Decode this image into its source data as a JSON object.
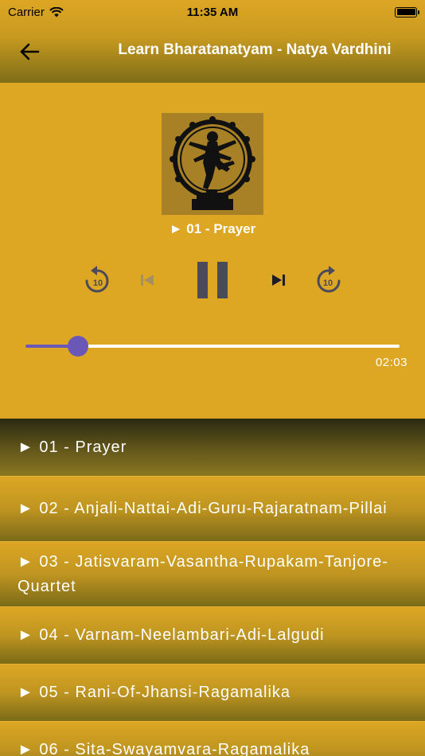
{
  "status_bar": {
    "carrier": "Carrier",
    "time": "11:35 AM",
    "battery_level": 1.0
  },
  "nav": {
    "title": "Learn Bharatanatyam - Natya Vardhini",
    "back_icon": "arrow-left-icon"
  },
  "player": {
    "now_playing": "► 01 - Prayer",
    "artwork": "nataraja-image",
    "controls": {
      "rewind_label": "10",
      "forward_label": "10",
      "rewind_icon": "rewind-10-icon",
      "previous_icon": "skip-previous-icon",
      "pause_icon": "pause-icon",
      "next_icon": "skip-next-icon",
      "forward_icon": "forward-10-icon"
    },
    "progress_fraction": 0.14,
    "elapsed_time": "02:03"
  },
  "tracks": [
    {
      "label": "► 01 - Prayer",
      "active": true
    },
    {
      "label": "► 02 - Anjali-Nattai-Adi-Guru-Rajaratnam-Pillai",
      "active": false
    },
    {
      "label": "► 03 - Jatisvaram-Vasantha-Rupakam-Tanjore-Quartet",
      "active": false
    },
    {
      "label": "► 04 - Varnam-Neelambari-Adi-Lalgudi",
      "active": false
    },
    {
      "label": "► 05 - Rani-Of-Jhansi-Ragamalika",
      "active": false
    },
    {
      "label": "► 06 - Sita-Swayamvara-Ragamalika",
      "active": false
    }
  ],
  "colors": {
    "background": "#dda623",
    "accent": "#6b57b6",
    "control": "#4a4a5a"
  }
}
